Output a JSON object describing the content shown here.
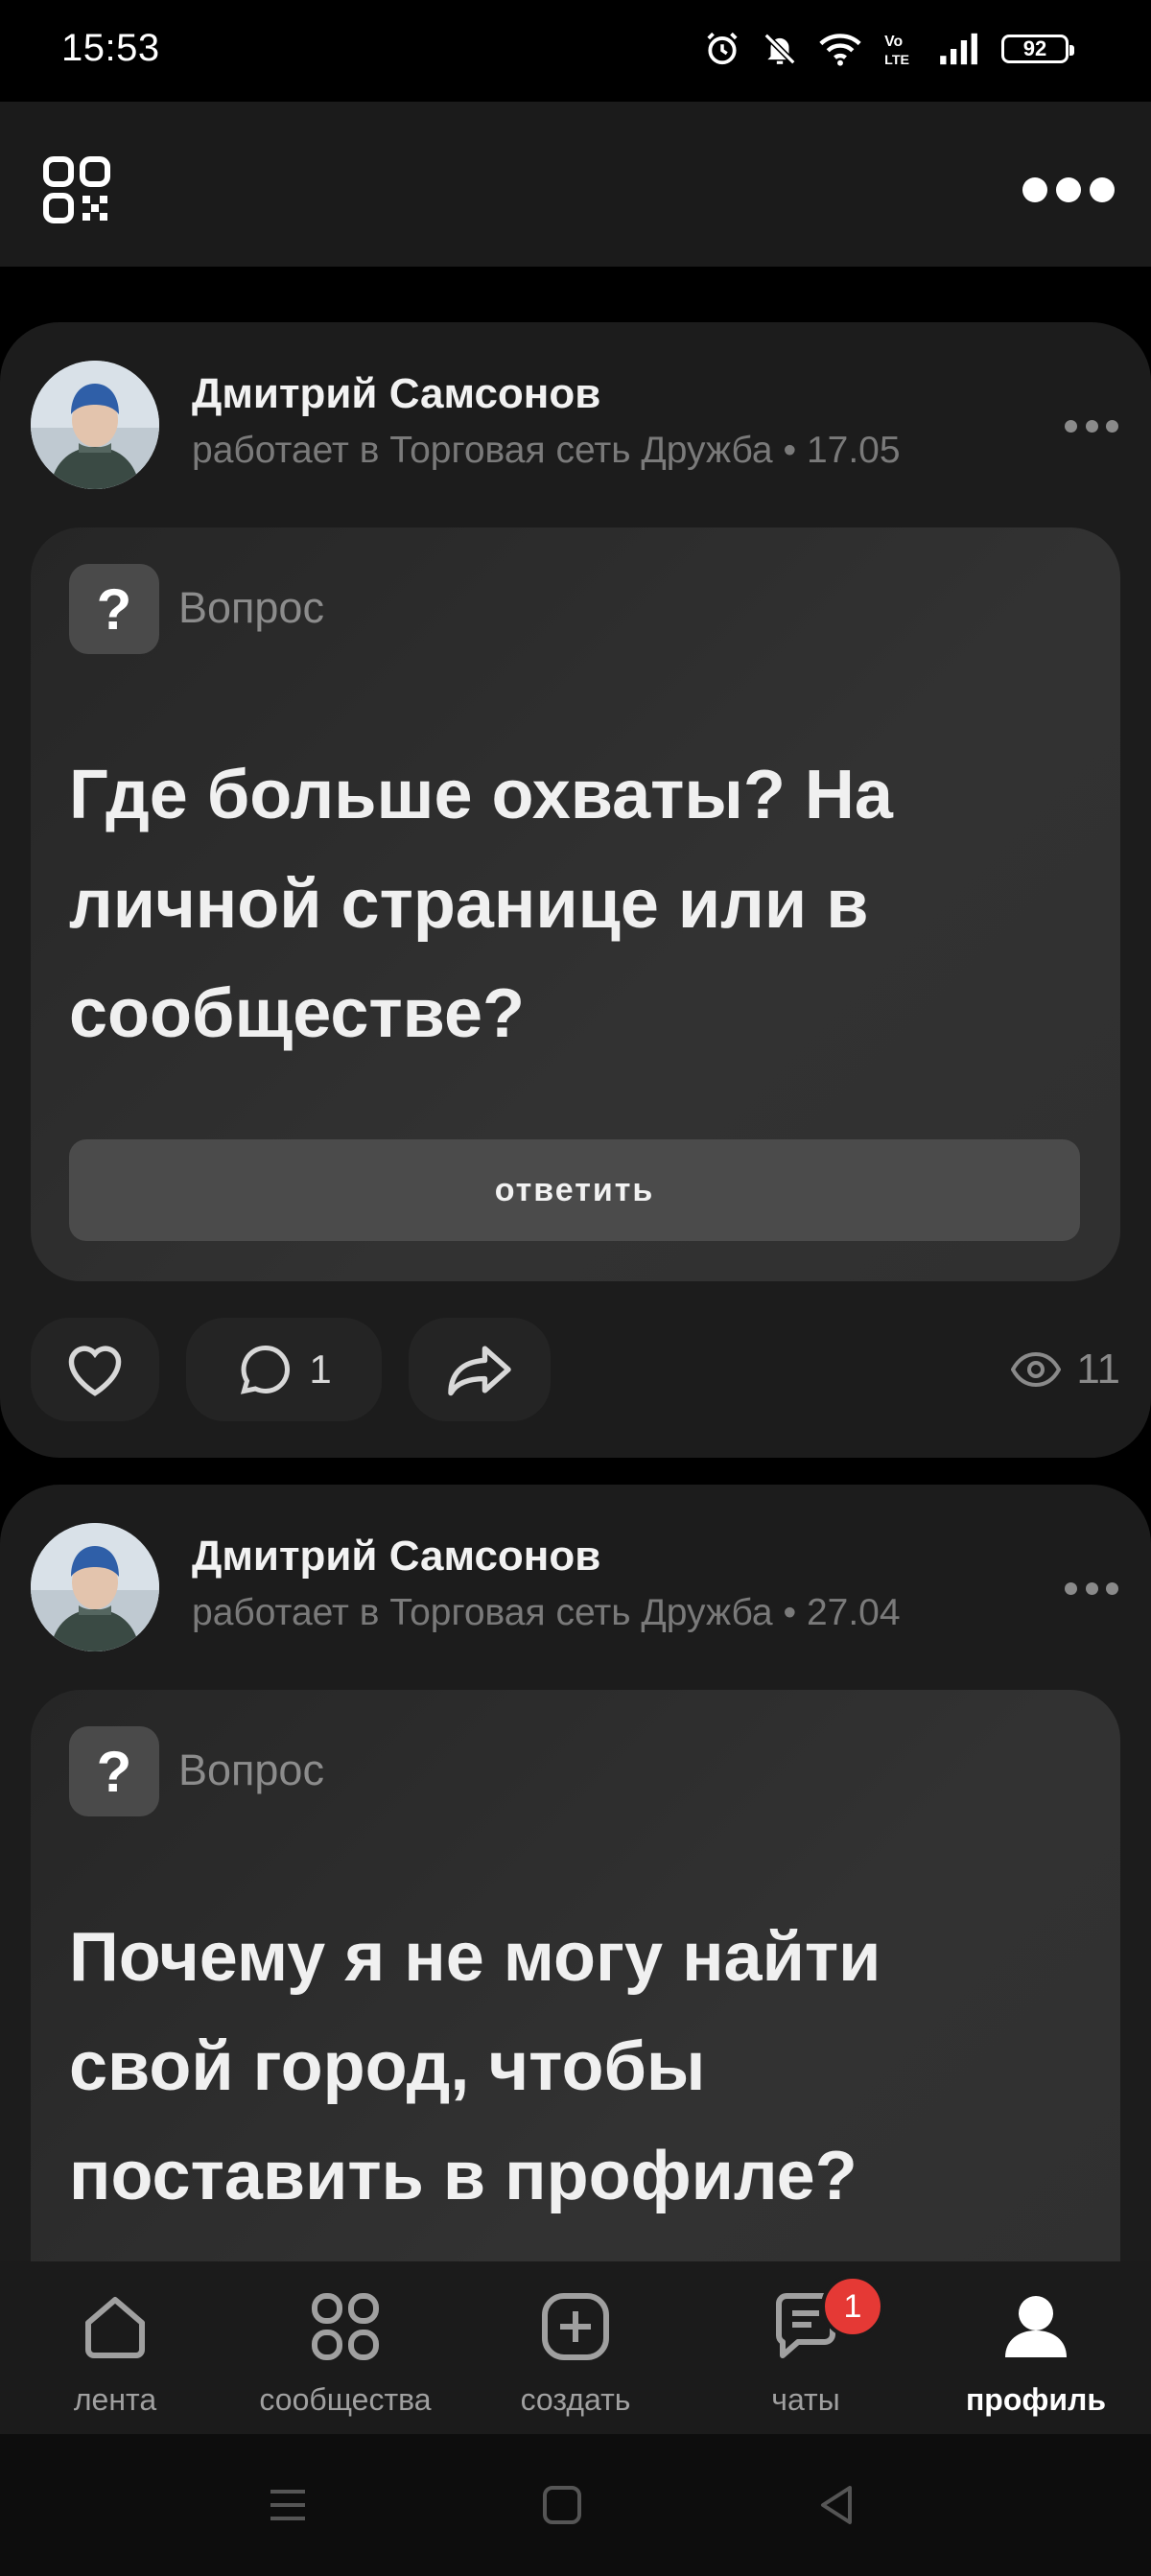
{
  "status_bar": {
    "time": "15:53",
    "battery": "92"
  },
  "header": {
    "qr_icon": "qr-code-icon",
    "more_icon": "more-icon"
  },
  "posts": [
    {
      "author": "Дмитрий Самсонов",
      "subtitle": "работает в Торговая сеть Дружба • 17.05",
      "badge": "?",
      "type_label": "Вопрос",
      "question": "Где больше охваты? На личной странице или в сообществе?",
      "answer_label": "ответить",
      "comments": "1",
      "views": "11"
    },
    {
      "author": "Дмитрий Самсонов",
      "subtitle": "работает в Торговая сеть Дружба • 27.04",
      "badge": "?",
      "type_label": "Вопрос",
      "question": "Почему я не могу найти свой город, чтобы поставить в профиле?"
    }
  ],
  "nav": {
    "items": [
      {
        "label": "лента",
        "icon": "home-icon"
      },
      {
        "label": "сообщества",
        "icon": "communities-icon"
      },
      {
        "label": "создать",
        "icon": "create-icon"
      },
      {
        "label": "чаты",
        "icon": "chat-icon",
        "badge": "1"
      },
      {
        "label": "профиль",
        "icon": "profile-icon",
        "active": true
      }
    ]
  }
}
